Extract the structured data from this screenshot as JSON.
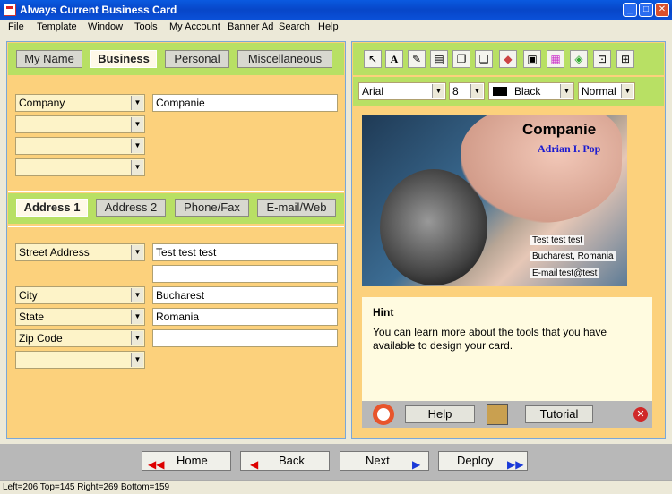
{
  "window": {
    "title": "Always Current Business Card"
  },
  "menu": [
    "File",
    "Template",
    "Window",
    "Tools",
    "My Account",
    "Banner Ad",
    "Search",
    "Help"
  ],
  "top_tabs": [
    "My Name",
    "Business",
    "Personal",
    "Miscellaneous"
  ],
  "company": {
    "selector": "Company",
    "value": "Companie"
  },
  "address_tabs": [
    "Address 1",
    "Address 2",
    "Phone/Fax",
    "E-mail/Web"
  ],
  "address": {
    "street_label": "Street Address",
    "street_value": "Test test test",
    "city_label": "City",
    "city_value": "Bucharest",
    "state_label": "State",
    "state_value": "Romania",
    "zip_label": "Zip Code",
    "zip_value": ""
  },
  "format": {
    "font": "Arial",
    "size": "8",
    "color": "Black",
    "style": "Normal",
    "color_hex": "#000000"
  },
  "card": {
    "company": "Companie",
    "name": "Adrian I. Pop",
    "line1": "Test test test",
    "line2": "Bucharest, Romania",
    "email_label": "E-mail",
    "email_value": "test@test",
    "name_color": "#1a1ad0"
  },
  "hint": {
    "title": "Hint",
    "text": "You can learn more about the tools that you have available to design your card."
  },
  "help_bar": {
    "help": "Help",
    "tutorial": "Tutorial"
  },
  "nav": {
    "home": "Home",
    "back": "Back",
    "next": "Next",
    "deploy": "Deploy"
  },
  "status": "Left=206 Top=145 Right=269 Bottom=159"
}
